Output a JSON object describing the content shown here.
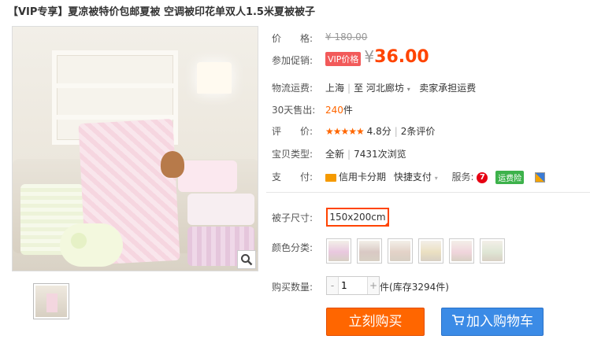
{
  "product": {
    "title": "【VIP专享】夏凉被特价包邮夏被 空调被印花单双人1.5米夏被被子"
  },
  "gallery": {
    "zoom_icon": "magnifier-icon"
  },
  "price": {
    "label": "价　　格:",
    "original": "¥ 180.00",
    "promo_label": "参加促销:",
    "vip_badge": "VIP价格",
    "currency": "¥",
    "current": "36.00"
  },
  "shipping": {
    "label": "物流运费:",
    "from": "上海",
    "to_prefix": "至",
    "to": "河北廊坊",
    "note": "卖家承担运费"
  },
  "sales": {
    "label": "30天售出:",
    "count": "240",
    "unit": "件"
  },
  "rating": {
    "label": "评　　价:",
    "stars": "★★★★★",
    "score": "4.8分",
    "reviews": "2条评价"
  },
  "item_type": {
    "label": "宝贝类型:",
    "condition": "全新",
    "views": "7431次浏览"
  },
  "payment": {
    "label": "支　　付:",
    "installment": "信用卡分期",
    "quick_pay": "快捷支付",
    "service_label": "服务:",
    "seven_days": "7",
    "freight_insurance": "运费险"
  },
  "options": {
    "size_label": "被子尺寸:",
    "size_selected": "150x200cm",
    "color_label": "颜色分类:",
    "swatch_colors": [
      "#e9c8df",
      "#d9c9c4",
      "#e3d2c8",
      "#ebe0c2",
      "#f0d5dc",
      "#dfe6d5"
    ]
  },
  "quantity": {
    "label": "购买数量:",
    "value": "1",
    "minus": "-",
    "plus": "+",
    "unit": "件",
    "stock": "(库存3294件)"
  },
  "actions": {
    "buy_now": "立刻购买",
    "add_to_cart": "加入购物车"
  }
}
